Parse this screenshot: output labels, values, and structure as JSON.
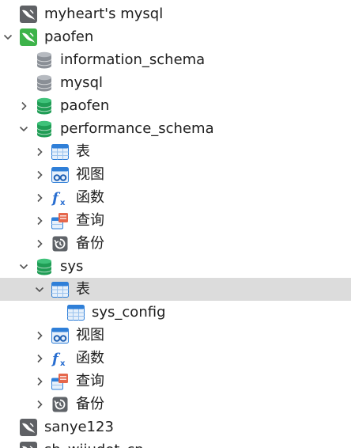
{
  "tree": [
    {
      "label": "myheart's mysql",
      "icon": "mysql-connection-icon",
      "expanded": null,
      "level": 0
    },
    {
      "label": "paofen",
      "icon": "mysql-connection-active-icon",
      "expanded": true,
      "level": 0
    },
    {
      "label": "information_schema",
      "icon": "database-gray-icon",
      "expanded": null,
      "level": 1
    },
    {
      "label": "mysql",
      "icon": "database-gray-icon",
      "expanded": null,
      "level": 1
    },
    {
      "label": "paofen",
      "icon": "database-green-icon",
      "expanded": false,
      "level": 1
    },
    {
      "label": "performance_schema",
      "icon": "database-green-icon",
      "expanded": true,
      "level": 1
    },
    {
      "label": "表",
      "icon": "table-icon",
      "expanded": false,
      "level": 2
    },
    {
      "label": "视图",
      "icon": "view-icon",
      "expanded": false,
      "level": 2
    },
    {
      "label": "函数",
      "icon": "function-icon",
      "expanded": false,
      "level": 2
    },
    {
      "label": "查询",
      "icon": "query-icon",
      "expanded": false,
      "level": 2
    },
    {
      "label": "备份",
      "icon": "backup-icon",
      "expanded": false,
      "level": 2
    },
    {
      "label": "sys",
      "icon": "database-green-icon",
      "expanded": true,
      "level": 1
    },
    {
      "label": "表",
      "icon": "table-icon",
      "expanded": true,
      "level": 2,
      "selected": true
    },
    {
      "label": "sys_config",
      "icon": "table-icon",
      "expanded": null,
      "level": 3
    },
    {
      "label": "视图",
      "icon": "view-icon",
      "expanded": false,
      "level": 2
    },
    {
      "label": "函数",
      "icon": "function-icon",
      "expanded": false,
      "level": 2
    },
    {
      "label": "查询",
      "icon": "query-icon",
      "expanded": false,
      "level": 2
    },
    {
      "label": "备份",
      "icon": "backup-icon",
      "expanded": false,
      "level": 2
    },
    {
      "label": "sanye123",
      "icon": "mysql-connection-icon",
      "expanded": null,
      "level": 0
    },
    {
      "label": "sh_wjjudot_cn",
      "icon": "mysql-connection-icon",
      "expanded": null,
      "level": 0
    }
  ],
  "colors": {
    "selection": "#dcdcdc",
    "connection_gray": "#5f6165",
    "connection_green": "#3db34a",
    "db_green": "#1f9d55",
    "db_gray": "#8a8f96",
    "table_blue": "#2f7fd8",
    "function_blue": "#2a6fd1",
    "query_orange": "#e5674c"
  }
}
